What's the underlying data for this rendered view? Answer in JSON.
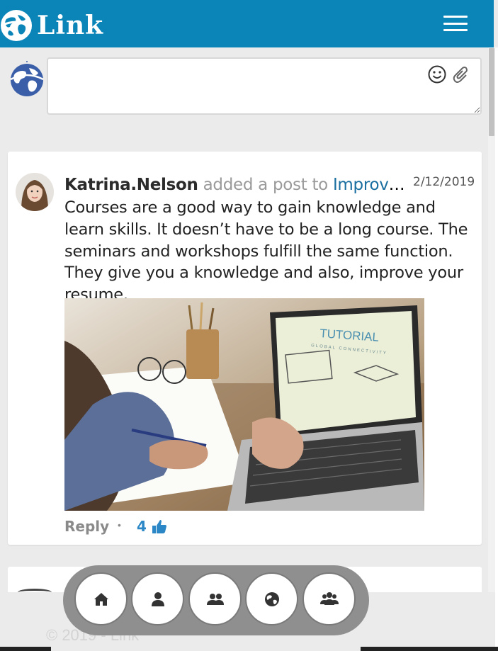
{
  "header": {
    "app_name": "Link",
    "brand_color": "#0b84b8",
    "menu_icon": "hamburger-menu-icon"
  },
  "composer": {
    "value": "",
    "placeholder": "",
    "emoji_icon": "emoji-icon",
    "attach_icon": "paperclip-icon"
  },
  "post": {
    "author": "Katrina.Nelson",
    "action": " added a post to ",
    "group": "Improve your resume",
    "date": "2/12/2019",
    "body": "Courses are a good way to gain knowledge and learn skills. It doesn’t have to be a long course. The seminars and workshops fulfill the same function. They give you a knowledge and also, improve your resume.",
    "image_caption": "TUTORIAL",
    "image_subcaption": "GLOBAL CONNECTIVITY",
    "reply_label": "Reply",
    "separator": "•",
    "like_count": "4",
    "link_color": "#1a6fa0",
    "like_color": "#2b87c6"
  },
  "footer": {
    "copyright": "© 2019 - Link"
  },
  "dock": {
    "items": [
      {
        "icon": "home-icon"
      },
      {
        "icon": "user-icon"
      },
      {
        "icon": "users-icon"
      },
      {
        "icon": "globe-icon"
      },
      {
        "icon": "group-icon"
      }
    ]
  }
}
